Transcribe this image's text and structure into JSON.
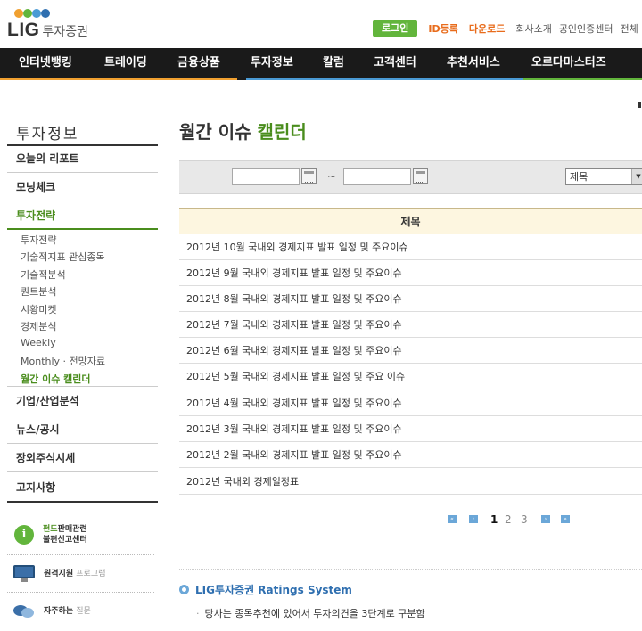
{
  "header": {
    "logo_main": "LIG",
    "logo_sub": "투자증권",
    "logo_colors": [
      "#f0a030",
      "#62b53c",
      "#4a9ad4",
      "#2f6fb0"
    ],
    "login_label": "로그인",
    "id_register": "ID등록",
    "download": "다운로드",
    "company": "회사소개",
    "cert_center": "공인인증센터",
    "more": "전체"
  },
  "nav": {
    "items": [
      "인터넷뱅킹",
      "트레이딩",
      "금융상품",
      "투자정보",
      "칼럼",
      "고객센터",
      "추천서비스",
      "오르다마스터즈"
    ],
    "bar_colors": [
      "#f0a030",
      "#f0a030",
      "#4a9ad4",
      "#4a9ad4",
      "#62b53c"
    ]
  },
  "sidebar": {
    "title": "투자정보",
    "items": [
      "오늘의 리포트",
      "모닝체크",
      "투자전략",
      "기업/산업분석",
      "뉴스/공시",
      "장외주식시세",
      "고지사항"
    ],
    "active": "투자전략",
    "subitems": [
      "투자전략",
      "기술적지표 관심종목",
      "기술적분석",
      "퀀트분석",
      "시황미켓",
      "경제분석",
      "Weekly",
      "Monthly · 전망자료",
      "월간 이슈 캘린더"
    ],
    "current_sub": "월간 이슈 캘린더",
    "boxes": [
      {
        "icon": "info-icon",
        "hl": "펀드",
        "line1": "판매관련",
        "line2": "불편신고센터"
      },
      {
        "icon": "monitor-icon",
        "main": "원격지원",
        "light": "프로그램"
      },
      {
        "icon": "chat-bubble-icon",
        "main": "자주하는",
        "light": "질문"
      }
    ]
  },
  "main": {
    "title_prefix": "월간 이슈",
    "title_highlight": "캘린더",
    "search": {
      "tilde": "~",
      "select_value": "제목",
      "select_arrow": "▼"
    },
    "table": {
      "header": "제목",
      "rows": [
        "2012년 10월 국내외 경제지표 발표 일정 및 주요이슈",
        "2012년 9월 국내외 경제지표 발표 일정 및 주요이슈",
        "2012년 8월 국내외 경제지표 발표 일정 및 주요이슈",
        "2012년 7월 국내외 경제지표 발표 일정 및 주요이슈",
        "2012년 6월 국내외 경제지표 발표 일정 및 주요이슈",
        "2012년 5월 국내외 경제지표 발표 일정 및 주요 이슈",
        "2012년 4월 국내외 경제지표 발표 일정 및 주요이슈",
        "2012년 3월 국내외 경제지표 발표 일정 및 주요이슈",
        "2012년 2월 국내외 경제지표 발표 일정 및 주요이슈",
        "2012년 국내외 경제일정표"
      ]
    },
    "pagination": {
      "first": "«",
      "prev": "‹",
      "pages": [
        "1",
        "2",
        "3"
      ],
      "current": "1",
      "next": "›",
      "last": "»"
    },
    "ratings": {
      "title": "LIG투자증권 Ratings System",
      "bullet": "·",
      "text": "당사는 종목추천에 있어서 투자의견을 3단계로 구분함"
    }
  }
}
